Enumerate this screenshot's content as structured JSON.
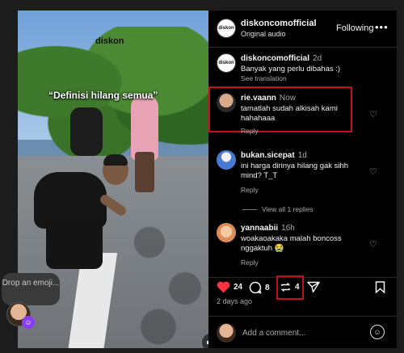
{
  "video": {
    "brand_watermark": "diskon",
    "caption": "“Definisi hilang semua”",
    "mute_icon": "speaker-muted-icon"
  },
  "emoji_drop": {
    "label": "Drop an emoji..."
  },
  "post": {
    "author": "diskoncomofficial",
    "author_avatar_text": "diskon",
    "audio_label": "Original audio",
    "follow_label": "Following",
    "more_icon": "•••"
  },
  "comments": [
    {
      "user": "diskoncomofficial",
      "time": "2d",
      "avatar_text": "diskon",
      "text": "Banyak yang perlu dibahas :)",
      "sub": "See translation"
    },
    {
      "user": "rie.vaann",
      "time": "Now",
      "text": "tamatlah sudah alkisah kami hahahaaa",
      "sub": "Reply",
      "highlighted": true
    },
    {
      "user": "bukan.sicepat",
      "time": "1d",
      "text": "ini harga dirinya hilang gak sihh mind? T_T",
      "sub": "Reply",
      "view_replies": "View all 1 replies"
    },
    {
      "user": "yannaabii",
      "time": "16h",
      "text": "woakaoakaka malah boncoss nggaktuh 😭",
      "sub": "Reply"
    }
  ],
  "actions": {
    "likes": "24",
    "comments": "8",
    "reposts": "4",
    "date": "2 days ago"
  },
  "comment_box": {
    "placeholder": "Add a comment..."
  },
  "colors": {
    "like": "#ff3040",
    "highlight_box": "#c0101a",
    "panel_bg": "#000000"
  }
}
